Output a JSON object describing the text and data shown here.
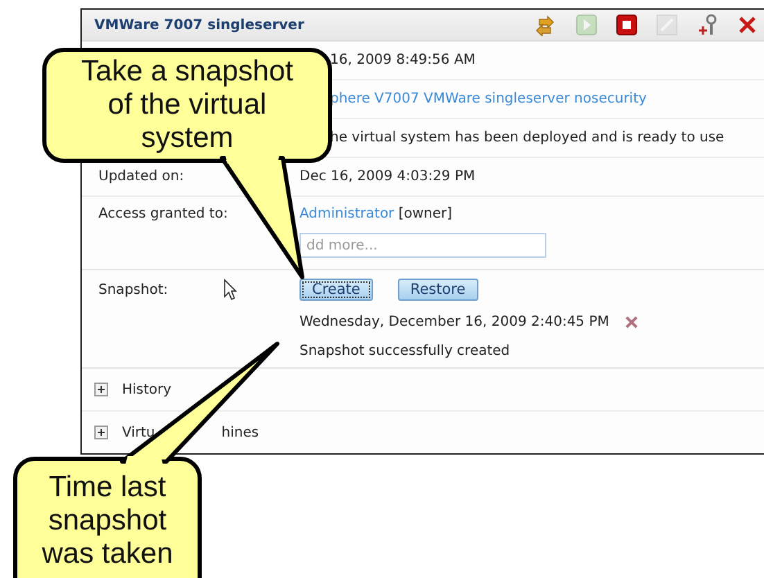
{
  "panel": {
    "title": "VMWare 7007 singleserver",
    "toolbar": [
      {
        "kind": "refresh",
        "disabled": false
      },
      {
        "kind": "start",
        "disabled": true
      },
      {
        "kind": "stop",
        "disabled": false
      },
      {
        "kind": "edit",
        "disabled": true
      },
      {
        "kind": "tool",
        "disabled": false
      },
      {
        "kind": "delete",
        "disabled": false
      }
    ],
    "rows": [
      {
        "value": "16, 2009 8:49:56 AM",
        "kind": "text"
      },
      {
        "value": "phere V7007 VMWare singleserver nosecurity",
        "kind": "link"
      },
      {
        "value": "he virtual system has been deployed and is ready to use",
        "kind": "text"
      },
      {
        "label": "Updated on:",
        "value": "Dec 16, 2009 4:03:29 PM",
        "kind": "text"
      }
    ],
    "access": {
      "label": "Access granted to:",
      "user": "Administrator",
      "role": "[owner]",
      "placeholder": "dd more..."
    },
    "snapshot": {
      "label": "Snapshot:",
      "buttons": [
        {
          "label": "Create",
          "focused": true
        },
        {
          "label": "Restore",
          "focused": false
        }
      ],
      "time": "Wednesday, December 16, 2009 2:40:45 PM",
      "status": "Snapshot successfully created"
    },
    "sections": [
      {
        "parts": [
          "History"
        ],
        "expanded": false
      },
      {
        "parts": [
          "Virtu",
          "hines"
        ],
        "expanded": false
      }
    ]
  },
  "callouts": [
    {
      "text": "Take a snapshot of the virtual system"
    },
    {
      "text": "Time last snapshot was taken"
    }
  ]
}
